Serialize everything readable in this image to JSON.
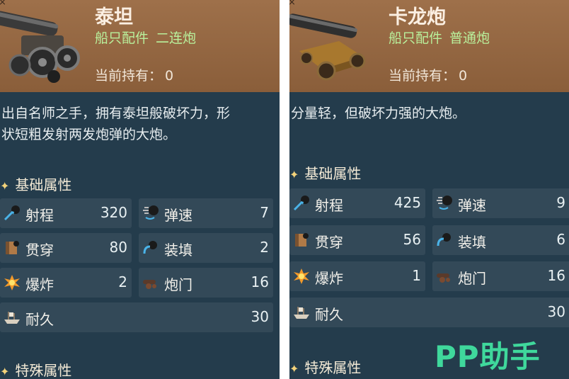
{
  "left": {
    "name": "泰坦",
    "category": "船只配件",
    "subtype": "二连炮",
    "owned_label": "当前持有：",
    "owned_value": "0",
    "description_line1": "出自名师之手，拥有泰坦般破坏力，形",
    "description_line2": "状短粗发射两发炮弹的大炮。",
    "basic_title": "基础属性",
    "special_title": "特殊属性",
    "stats": {
      "range": {
        "label": "射程",
        "value": "320"
      },
      "speed": {
        "label": "弹速",
        "value": "7"
      },
      "pierce": {
        "label": "贯穿",
        "value": "80"
      },
      "reload": {
        "label": "装填",
        "value": "2"
      },
      "explode": {
        "label": "爆炸",
        "value": "2"
      },
      "gunport": {
        "label": "炮门",
        "value": "16"
      },
      "durability": {
        "label": "耐久",
        "value": "30"
      }
    }
  },
  "right": {
    "name": "卡龙炮",
    "category": "船只配件",
    "subtype": "普通炮",
    "owned_label": "当前持有：",
    "owned_value": "0",
    "description_line1": "分量轻，但破坏力强的大炮。",
    "basic_title": "基础属性",
    "special_title": "特殊属性",
    "stats": {
      "range": {
        "label": "射程",
        "value": "425"
      },
      "speed": {
        "label": "弹速",
        "value": "9"
      },
      "pierce": {
        "label": "贯穿",
        "value": "56"
      },
      "reload": {
        "label": "装填",
        "value": "6"
      },
      "explode": {
        "label": "爆炸",
        "value": "1"
      },
      "gunport": {
        "label": "炮门",
        "value": "16"
      },
      "durability": {
        "label": "耐久",
        "value": "30"
      }
    }
  },
  "close_glyph": "×",
  "star_glyph": "✦",
  "watermark": "PP助手",
  "colors": {
    "accent_green": "#3fd89c",
    "subtype_green": "#b9f09c",
    "panel": "#243c4c",
    "header": "#9e704a"
  }
}
